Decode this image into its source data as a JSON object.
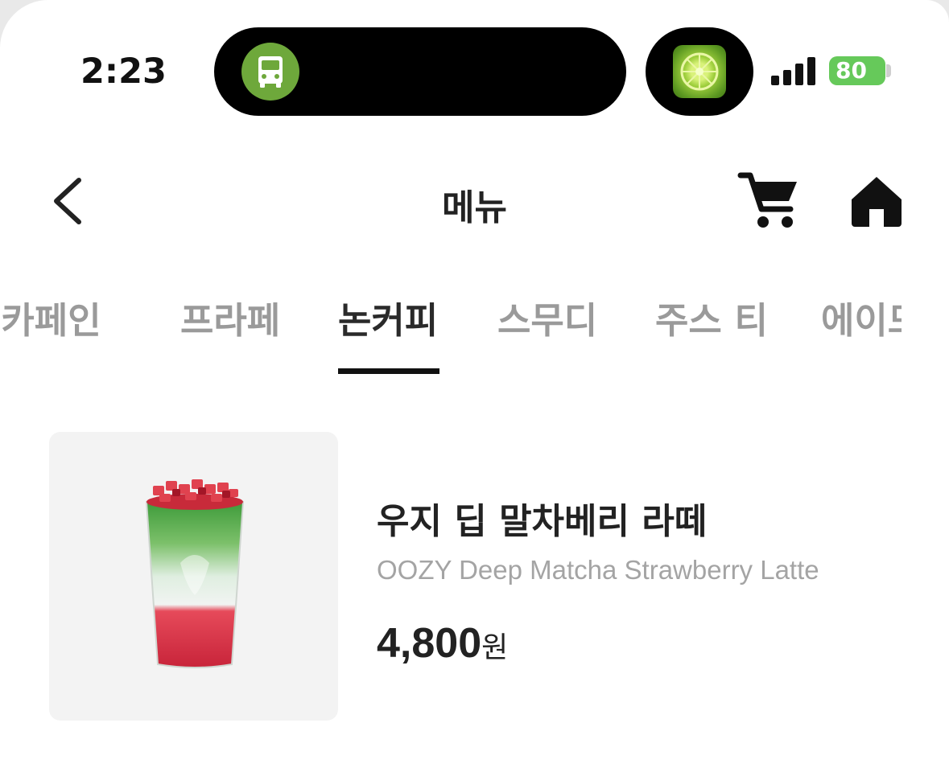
{
  "status_bar": {
    "time": "2:23",
    "battery": "80",
    "live_activity_icon": "bus-icon",
    "app_icon": "lime-app-icon"
  },
  "header": {
    "title": "메뉴",
    "back_icon": "chevron-left-icon",
    "cart_icon": "cart-icon",
    "home_icon": "home-icon"
  },
  "tabs": [
    {
      "label": "디카페인",
      "active": false
    },
    {
      "label": "프라페",
      "active": false
    },
    {
      "label": "논커피",
      "active": true
    },
    {
      "label": "스무디",
      "active": false
    },
    {
      "label": "주스 티",
      "active": false
    },
    {
      "label": "에이드",
      "active": false
    }
  ],
  "products": [
    {
      "name_ko": "우지 딥 말차베리 라떼",
      "name_en": "OOZY Deep Matcha Strawberry Latte",
      "price": "4,800",
      "currency": "원"
    }
  ],
  "colors": {
    "accent": "#111111",
    "inactive_tab": "#9a9a9a",
    "subtitle": "#a4a4a4",
    "bus_badge": "#6ea83b",
    "battery": "#66c95a"
  }
}
